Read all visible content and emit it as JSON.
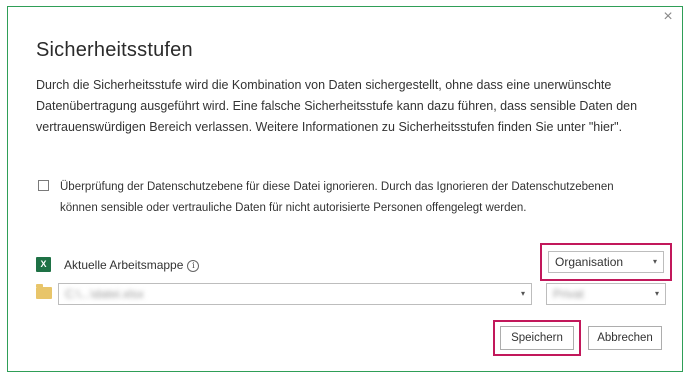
{
  "dialog": {
    "title": "Sicherheitsstufen",
    "close_glyph": "×",
    "description_before_link": "Durch die Sicherheitsstufe wird die Kombination von Daten sichergestellt, ohne dass eine unerwünschte Datenübertragung ausgeführt wird. Eine falsche Sicherheitsstufe kann dazu führen, dass sensible Daten den vertrauenswürdigen Bereich verlassen. Weitere Informationen zu Sicherheitsstufen finden Sie unter \"",
    "description_link": "hier",
    "description_after_link": "\".",
    "ignore_checkbox": {
      "checked": false,
      "label": "Überprüfung der Datenschutzebene für diese Datei ignorieren. Durch das Ignorieren der Datenschutzebenen können sensible oder vertrauliche Daten für nicht autorisierte Personen offengelegt werden."
    },
    "sources": [
      {
        "icon": "excel-icon",
        "label": "Aktuelle Arbeitsmappe",
        "info_glyph": "i",
        "level": "Organisation"
      },
      {
        "icon": "folder-icon",
        "path": "C:\\...\\datei.xlsx",
        "level": "Privat"
      }
    ],
    "dropdown_arrow": "▾",
    "buttons": {
      "save": "Speichern",
      "cancel": "Abbrechen"
    },
    "colors": {
      "dialog_border": "#2f9e57",
      "highlight": "#c2185b",
      "excel_green": "#1e7145",
      "folder": "#e8c56a"
    }
  }
}
